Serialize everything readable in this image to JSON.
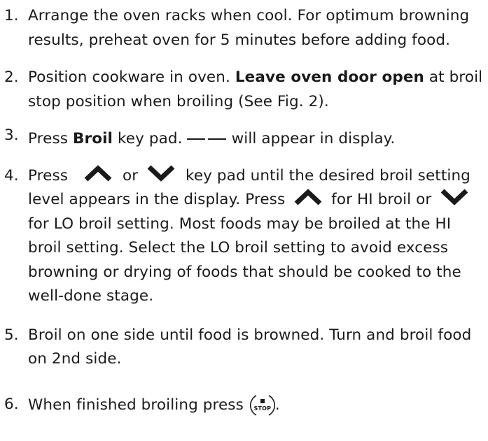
{
  "steps": [
    {
      "number": "1.",
      "text": "Arrange the oven racks when cool. For optimum browning results, preheat oven for 5 minutes before adding food."
    },
    {
      "number": "2.",
      "text_before": "Position cookware in oven. ",
      "bold": "Leave oven door open",
      "text_after": " at broil stop position when broiling (See Fig. 2)."
    },
    {
      "number": "3.",
      "text_before": "Press ",
      "bold": "Broil",
      "text_mid": " key pad.",
      "text_after": "will appear in display."
    },
    {
      "number": "4.",
      "seg1": "Press",
      "seg2": "or",
      "seg3": "key pad until the desired broil setting level appears in the display. Press",
      "seg4": "for HI broil or",
      "seg5": "for LO broil setting. Most foods may be broiled at the HI broil setting. Select the LO broil setting to avoid excess browning or drying of foods that should be cooked to the well-done stage."
    },
    {
      "number": "5.",
      "text": "Broil on one side until food is browned. Turn and broil food on 2nd side."
    },
    {
      "number": "6.",
      "text": "When finished broiling press",
      "stop_label": "STOP",
      "text_after": "."
    }
  ],
  "icons": {
    "up": "chevron-up-icon",
    "down": "chevron-down-icon",
    "stop": "stop-key-icon"
  }
}
